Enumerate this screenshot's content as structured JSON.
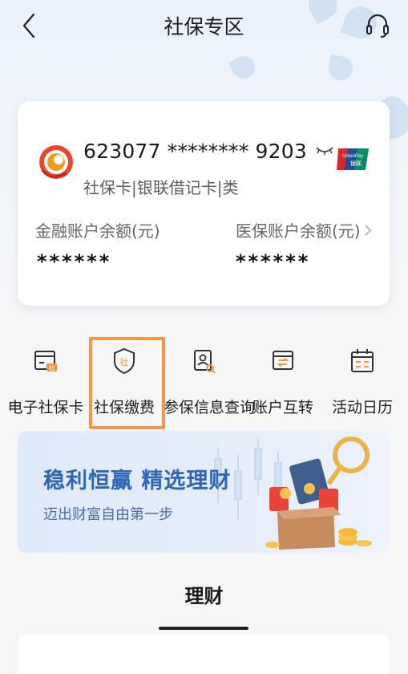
{
  "header": {
    "title": "社保专区",
    "back_icon": "chevron-left-icon",
    "support_icon": "headset-icon"
  },
  "card": {
    "number": "623077 ******** 9203",
    "type": "社保卡|银联借记卡|类",
    "brand_icon": "bank-logo-icon",
    "network": "UnionPay银联",
    "balances": [
      {
        "label": "金融账户余额(元)",
        "value": "******"
      },
      {
        "label": "医保账户余额(元)",
        "value": "******"
      }
    ]
  },
  "quick_actions": [
    {
      "label": "电子社保卡",
      "icon": "e-card-icon"
    },
    {
      "label": "社保缴费",
      "icon": "shield-she-icon"
    },
    {
      "label": "参保信息查询",
      "icon": "doc-search-icon"
    },
    {
      "label": "账户互转",
      "icon": "transfer-icon"
    },
    {
      "label": "活动日历",
      "icon": "calendar-icon"
    }
  ],
  "banner": {
    "title": "稳利恒赢 精选理财",
    "subtitle": "迈出财富自由第一步"
  },
  "tabs": [
    {
      "label": "理财",
      "active": true
    }
  ],
  "colors": {
    "accent_orange": "#f39645",
    "banner_text": "#2e66b8",
    "unionpay_red": "#d7282f",
    "unionpay_blue": "#1c4e9c",
    "unionpay_green": "#0c8b67"
  }
}
